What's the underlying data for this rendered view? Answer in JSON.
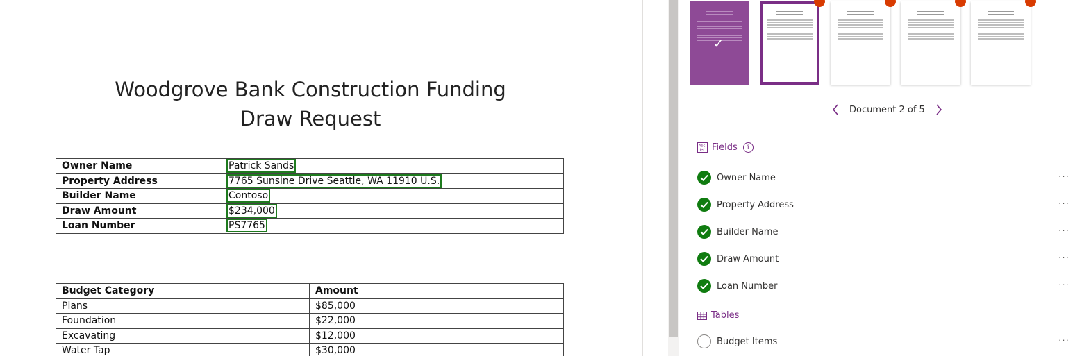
{
  "document": {
    "title_line1": "Woodgrove Bank Construction Funding",
    "title_line2": "Draw Request",
    "info_rows": [
      {
        "label": "Owner Name",
        "value": "Patrick Sands"
      },
      {
        "label": "Property Address",
        "value": "7765 Sunsine Drive Seattle, WA 11910 U.S."
      },
      {
        "label": "Builder Name",
        "value": "Contoso"
      },
      {
        "label": "Draw Amount",
        "value": "$234,000"
      },
      {
        "label": "Loan Number",
        "value": "PS7765"
      }
    ],
    "budget_headers": [
      "Budget Category",
      "Amount"
    ],
    "budget_rows": [
      {
        "category": "Plans",
        "amount": "$85,000"
      },
      {
        "category": "Foundation",
        "amount": "$22,000"
      },
      {
        "category": "Excavating",
        "amount": "$12,000"
      },
      {
        "category": "Water Tap",
        "amount": "$30,000"
      }
    ],
    "highlight_color": "#1e7a1e"
  },
  "panel": {
    "thumbnails": [
      {
        "state": "checked",
        "icon": "checkmark-icon"
      },
      {
        "state": "active"
      },
      {
        "state": "flagged"
      },
      {
        "state": "flagged"
      },
      {
        "state": "flagged"
      }
    ],
    "pager_label": "Document 2 of 5",
    "fields_header": "Fields",
    "fields": [
      {
        "name": "Owner Name",
        "complete": true
      },
      {
        "name": "Property Address",
        "complete": true
      },
      {
        "name": "Builder Name",
        "complete": true
      },
      {
        "name": "Draw Amount",
        "complete": true
      },
      {
        "name": "Loan Number",
        "complete": true
      }
    ],
    "tables_header": "Tables",
    "tables": [
      {
        "name": "Budget Items",
        "complete": false
      }
    ],
    "more_label": "···",
    "accent_color": "#7a2e86",
    "success_color": "#107c10",
    "flag_color": "#d83b01"
  }
}
